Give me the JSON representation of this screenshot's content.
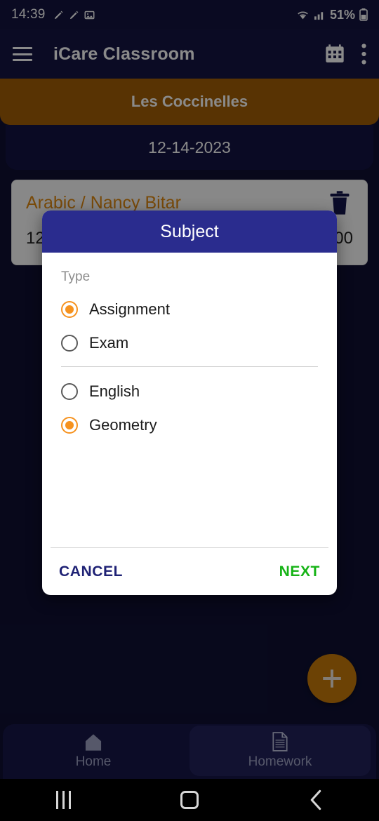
{
  "status_bar": {
    "time": "14:39",
    "battery_percent": "51%",
    "icons": [
      "pen-icon",
      "pen-icon",
      "image-icon",
      "wifi-icon",
      "cellular-signal-icon",
      "battery-icon"
    ]
  },
  "app_bar": {
    "title": "iCare Classroom",
    "menu_icon": "hamburger-menu-icon",
    "calendar_icon": "calendar-icon",
    "overflow_icon": "overflow-menu-icon"
  },
  "class_header": {
    "class_name": "Les Coccinelles",
    "date": "12-14-2023",
    "band_color": "#a35f06",
    "date_bg_color": "#141444"
  },
  "homework_card": {
    "subject_teacher": "Arabic / Nancy Bitar",
    "time_left": "12",
    "time_right": "00",
    "delete_icon": "trash-icon",
    "title_color": "#e08a12"
  },
  "fab": {
    "icon": "plus-icon",
    "color": "#c87b0a"
  },
  "bottom_nav": {
    "items": [
      {
        "label": "Home",
        "icon": "home-icon",
        "active": false
      },
      {
        "label": "Homework",
        "icon": "document-icon",
        "active": true
      }
    ]
  },
  "system_nav": {
    "recents_icon": "recents-icon",
    "home_icon": "home-circle-icon",
    "back_icon": "back-chevron-icon"
  },
  "dialog": {
    "title": "Subject",
    "header_color": "#2a2c8e",
    "type_label": "Type",
    "accent_color": "#f6921e",
    "type_options": [
      {
        "label": "Assignment",
        "selected": true
      },
      {
        "label": "Exam",
        "selected": false
      }
    ],
    "subject_options": [
      {
        "label": "English",
        "selected": false
      },
      {
        "label": "Geometry",
        "selected": true
      }
    ],
    "cancel_label": "CANCEL",
    "next_label": "NEXT",
    "cancel_color": "#1f2275",
    "next_color": "#16b316"
  }
}
